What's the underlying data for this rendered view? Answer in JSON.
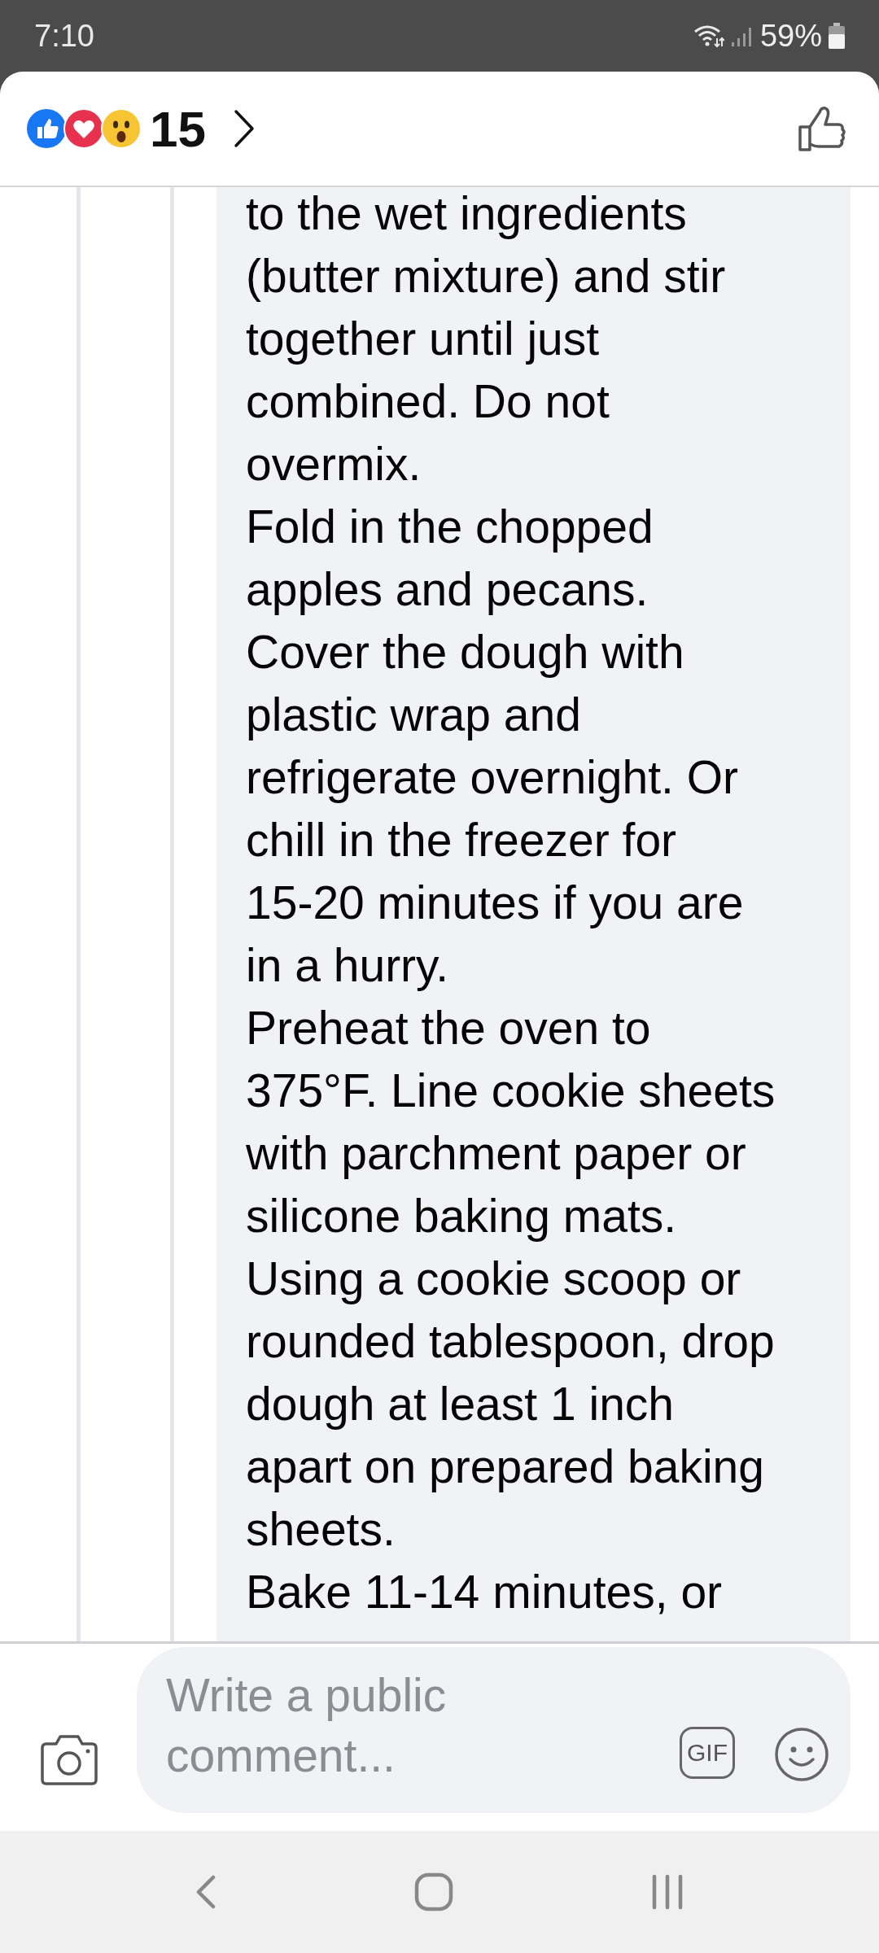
{
  "status_bar": {
    "time": "7:10",
    "battery": "59%"
  },
  "header": {
    "reaction_count": "15"
  },
  "comment": {
    "lines": [
      "to the wet ingredients",
      "(butter mixture) and stir",
      "together until just",
      "combined. Do not",
      "overmix.",
      "Fold in the chopped",
      "apples and pecans.",
      "Cover the dough with",
      "plastic wrap and",
      "refrigerate overnight. Or",
      "chill in the freezer for",
      "15-20 minutes if you are",
      "in a hurry.",
      "Preheat the oven to",
      "375°F. Line cookie sheets",
      "with parchment paper or",
      "silicone baking mats.",
      "Using a cookie scoop or",
      "rounded tablespoon, drop",
      "dough at least 1 inch",
      "apart on prepared baking",
      "sheets.",
      "Bake 11-14 minutes, or"
    ]
  },
  "composer": {
    "placeholder": "Write a public comment...",
    "gif_label": "GIF"
  }
}
